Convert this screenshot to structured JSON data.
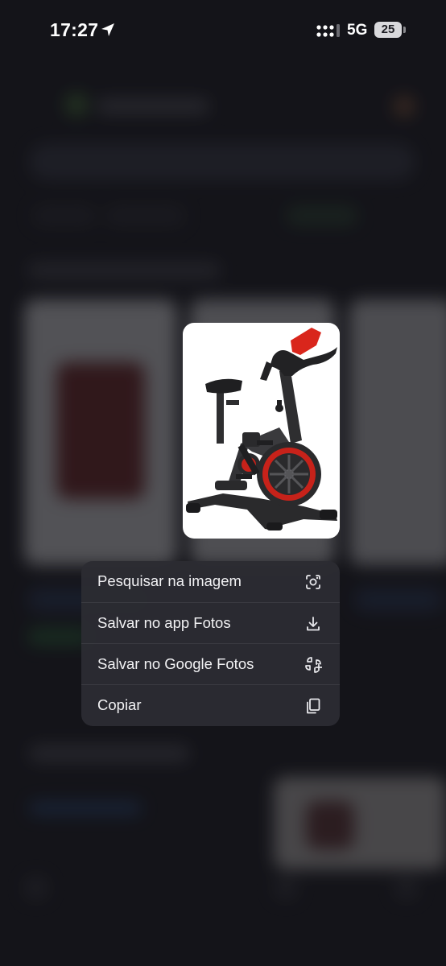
{
  "status_bar": {
    "time": "17:27",
    "network": "5G",
    "battery": "25"
  },
  "preview": {
    "icon": "exercise-bike-image"
  },
  "menu": {
    "items": [
      {
        "label": "Pesquisar na imagem",
        "icon": "lens-icon"
      },
      {
        "label": "Salvar no app Fotos",
        "icon": "download-icon"
      },
      {
        "label": "Salvar no Google Fotos",
        "icon": "google-photos-add-icon"
      },
      {
        "label": "Copiar",
        "icon": "copy-icon"
      }
    ]
  },
  "colors": {
    "background": "#1c1c22",
    "menu": "#2c2c32",
    "accent_red": "#d9261c"
  }
}
